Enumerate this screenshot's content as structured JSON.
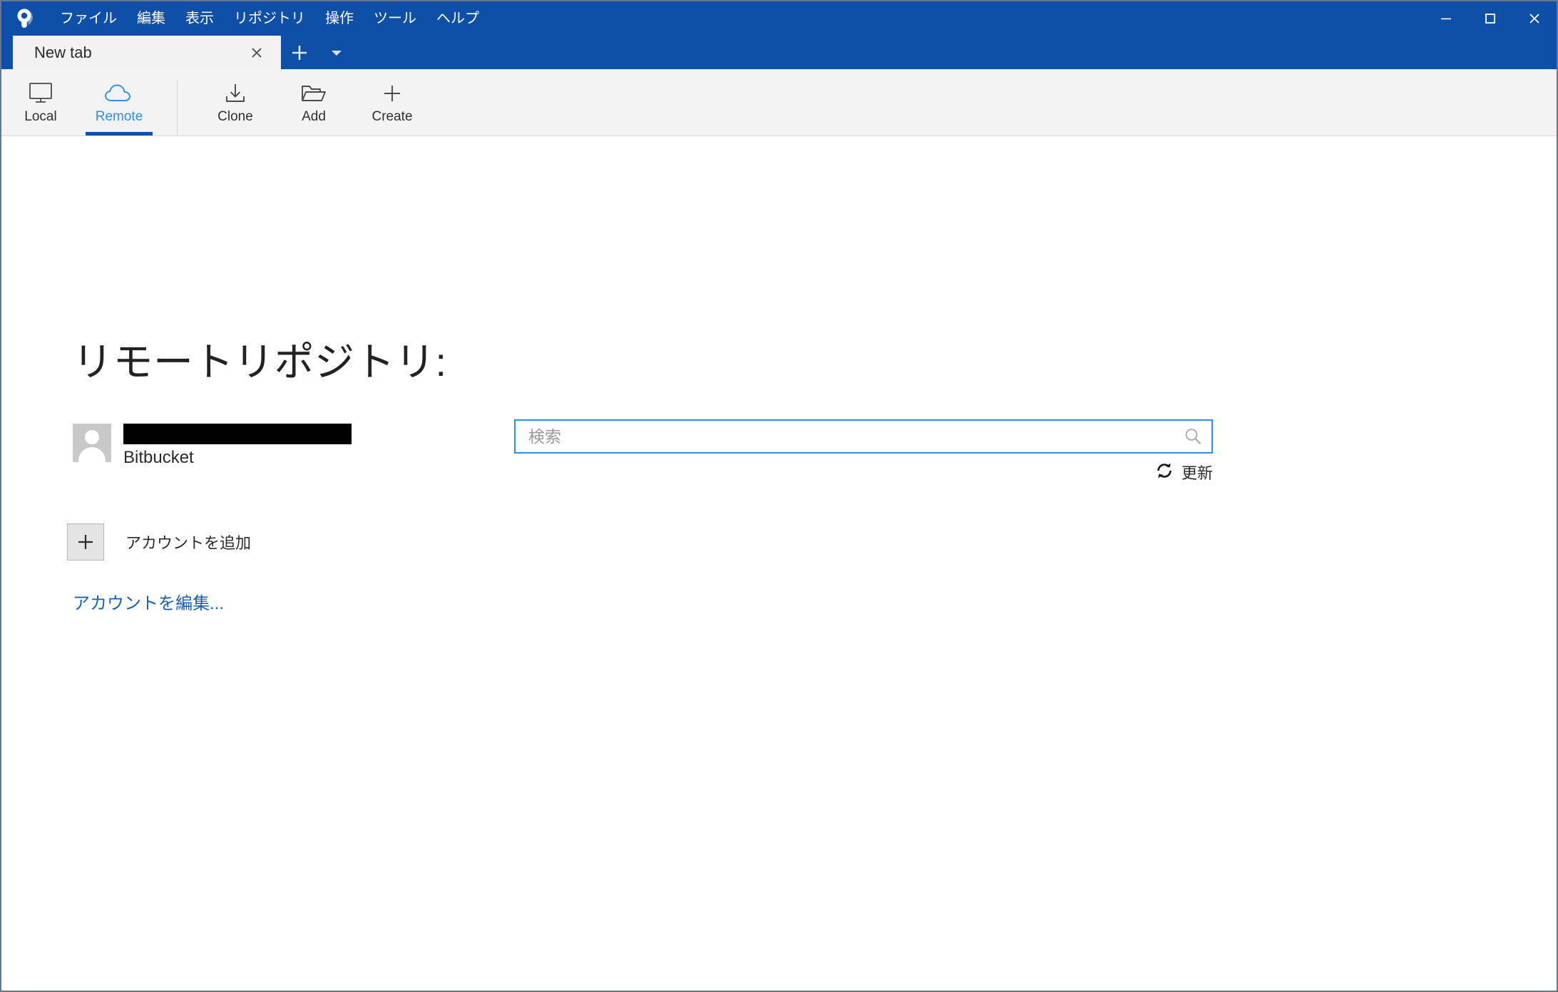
{
  "window": {
    "title": "New tab",
    "accent_blue": "#0e4fa8",
    "link_blue": "#1a5fb4",
    "focus_blue": "#2f8ef4",
    "app_icon": "sourcetree-logo-icon"
  },
  "menubar": {
    "items": [
      {
        "label": "ファイル",
        "name": "menu-file"
      },
      {
        "label": "編集",
        "name": "menu-edit"
      },
      {
        "label": "表示",
        "name": "menu-view"
      },
      {
        "label": "リポジトリ",
        "name": "menu-repository"
      },
      {
        "label": "操作",
        "name": "menu-actions"
      },
      {
        "label": "ツール",
        "name": "menu-tools"
      },
      {
        "label": "ヘルプ",
        "name": "menu-help"
      }
    ]
  },
  "window_controls": {
    "minimize": "minimize-icon",
    "maximize": "maximize-icon",
    "close": "close-icon"
  },
  "tabs": {
    "items": [
      {
        "label": "New tab",
        "active": true
      }
    ],
    "close_icon": "close-icon",
    "new_tab_icon": "plus-icon",
    "tab_menu_icon": "chevron-down-icon"
  },
  "toolbar": {
    "left_group": [
      {
        "label": "Local",
        "icon": "monitor-icon",
        "active": false
      },
      {
        "label": "Remote",
        "icon": "cloud-icon",
        "active": true
      }
    ],
    "right_group": [
      {
        "label": "Clone",
        "icon": "download-icon"
      },
      {
        "label": "Add",
        "icon": "folder-open-icon"
      },
      {
        "label": "Create",
        "icon": "plus-icon"
      }
    ]
  },
  "main": {
    "page_title": "リモートリポジトリ:",
    "account": {
      "name_redacted": true,
      "service": "Bitbucket",
      "avatar_icon": "user-avatar-icon"
    },
    "add_account": {
      "icon": "plus-icon",
      "label": "アカウントを追加"
    },
    "edit_account_link": "アカウントを編集...",
    "search": {
      "value": "",
      "placeholder": "検索",
      "icon": "search-icon"
    },
    "refresh": {
      "label": "更新",
      "icon": "refresh-icon"
    }
  }
}
